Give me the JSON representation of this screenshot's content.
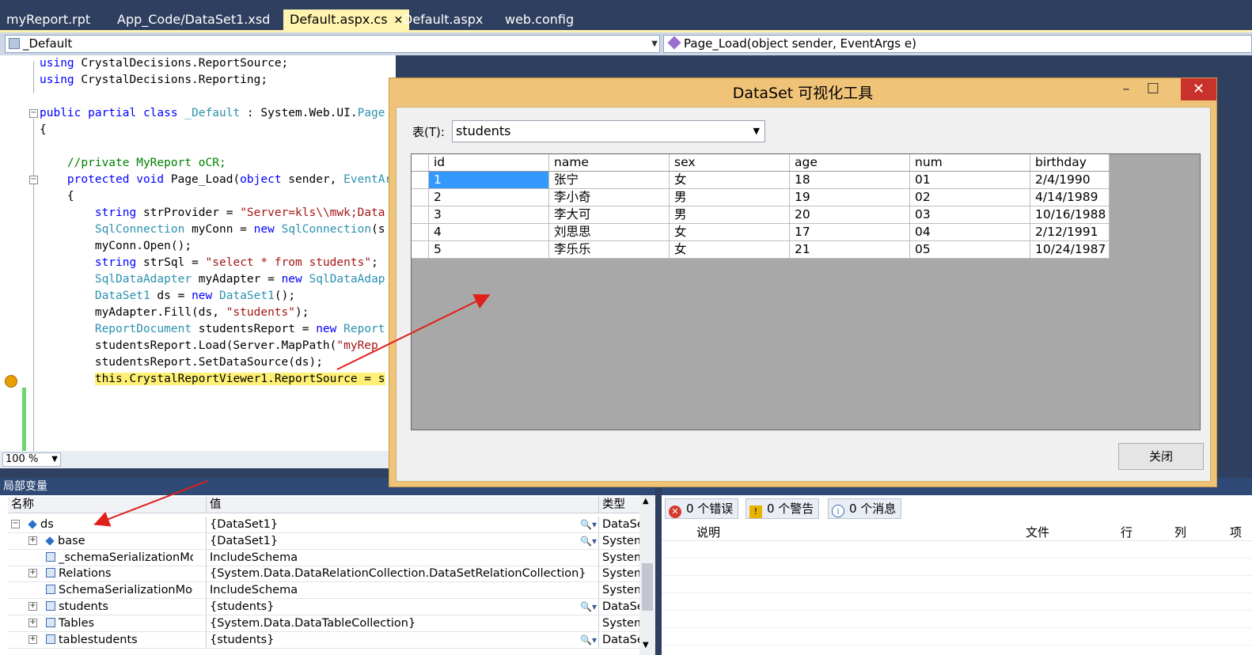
{
  "tabs": [
    {
      "label": "myReport.rpt"
    },
    {
      "label": "App_Code/DataSet1.xsd"
    },
    {
      "label": "Default.aspx.cs",
      "close": "✕"
    },
    {
      "label": "Default.aspx"
    },
    {
      "label": "web.config"
    }
  ],
  "nav": {
    "class_combo": "_Default",
    "method_combo": "Page_Load(object sender, EventArgs e)"
  },
  "editor": {
    "zoom": "100 %"
  },
  "dialog": {
    "title": "DataSet 可视化工具",
    "table_label": "表(T):",
    "table_value": "students",
    "close_button": "关闭",
    "columns": [
      "id",
      "name",
      "sex",
      "age",
      "num",
      "birthday"
    ],
    "rows": [
      [
        "1",
        "张宁",
        "女",
        "18",
        "01",
        "2/4/1990"
      ],
      [
        "2",
        "李小奇",
        "男",
        "19",
        "02",
        "4/14/1989"
      ],
      [
        "3",
        "李大可",
        "男",
        "20",
        "03",
        "10/16/1988"
      ],
      [
        "4",
        "刘思思",
        "女",
        "17",
        "04",
        "2/12/1991"
      ],
      [
        "5",
        "李乐乐",
        "女",
        "21",
        "05",
        "10/24/1987"
      ]
    ]
  },
  "locals": {
    "title": "局部变量",
    "headers": {
      "name": "名称",
      "value": "值",
      "type": "类型"
    },
    "rows": [
      {
        "name": "ds",
        "value": "{DataSet1}",
        "type": "DataSe"
      },
      {
        "name": "base",
        "value": "{DataSet1}",
        "type": "System"
      },
      {
        "name": "_schemaSerializationMode",
        "value": "IncludeSchema",
        "type": "System"
      },
      {
        "name": "Relations",
        "value": "{System.Data.DataRelationCollection.DataSetRelationCollection}",
        "type": "System"
      },
      {
        "name": "SchemaSerializationMode",
        "value": "IncludeSchema",
        "type": "System"
      },
      {
        "name": "students",
        "value": "{students}",
        "type": "DataSe"
      },
      {
        "name": "Tables",
        "value": "{System.Data.DataTableCollection}",
        "type": "System"
      },
      {
        "name": "tablestudents",
        "value": "{students}",
        "type": "DataSe"
      }
    ]
  },
  "errors": {
    "errors_btn": "0 个错误",
    "warnings_btn": "0 个警告",
    "messages_btn": "0 个消息",
    "col_desc": "说明",
    "col_file": "文件",
    "col_line": "行",
    "col_col": "列",
    "col_proj": "项"
  }
}
